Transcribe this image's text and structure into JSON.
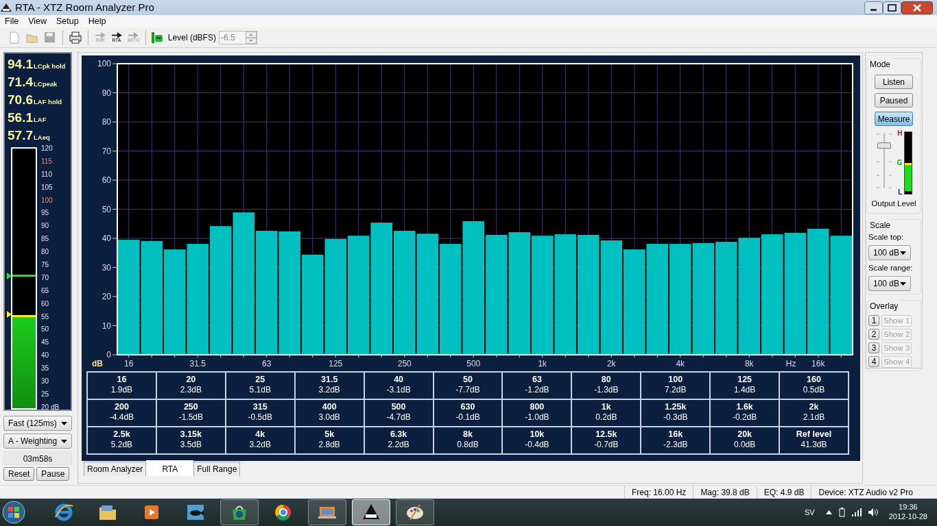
{
  "window": {
    "title": "RTA - XTZ Room Analyzer Pro"
  },
  "menu": [
    "File",
    "View",
    "Setup",
    "Help"
  ],
  "toolbar": {
    "buttons": [
      {
        "kind": "new",
        "disabled": true
      },
      {
        "kind": "open",
        "disabled": true
      },
      {
        "kind": "save",
        "disabled": true
      },
      {
        "kind": "print",
        "disabled": false
      },
      {
        "kind": "arrow",
        "label": "ROM",
        "disabled": true
      },
      {
        "kind": "arrow",
        "label": "RTA",
        "disabled": false
      },
      {
        "kind": "arrow",
        "label": "BOTH",
        "disabled": true
      }
    ],
    "level": {
      "label": "Level (dBFS)",
      "value": "-6.5",
      "disabled": true
    }
  },
  "readouts": [
    {
      "value": "94.1",
      "label": "LCpk hold"
    },
    {
      "value": "71.4",
      "label": "LCpeak"
    },
    {
      "value": "70.6",
      "label": "LAF hold"
    },
    {
      "value": "56.1",
      "label": "LAF"
    },
    {
      "value": "57.7",
      "label": "LAeq"
    }
  ],
  "meter": {
    "fill": {
      "level": 0.36
    },
    "hold": {
      "level": 0.506
    },
    "scale": [
      {
        "label": "120",
        "marked": false
      },
      {
        "label": "115",
        "marked": true
      },
      {
        "label": "110",
        "marked": false
      },
      {
        "label": "105",
        "marked": false
      },
      {
        "label": "100",
        "marked": true
      },
      {
        "label": "95",
        "marked": false
      },
      {
        "label": "90",
        "marked": false
      },
      {
        "label": "85",
        "marked": false
      },
      {
        "label": "80",
        "marked": false
      },
      {
        "label": "75",
        "marked": false
      },
      {
        "label": "70",
        "marked": false
      },
      {
        "label": "65",
        "marked": false
      },
      {
        "label": "60",
        "marked": false
      },
      {
        "label": "55",
        "marked": false
      },
      {
        "label": "50",
        "marked": false
      },
      {
        "label": "45",
        "marked": false
      },
      {
        "label": "40",
        "marked": false
      },
      {
        "label": "35",
        "marked": false
      },
      {
        "label": "30",
        "marked": false
      },
      {
        "label": "25",
        "marked": false
      },
      {
        "label": "20 dB",
        "marked": false
      }
    ]
  },
  "response_select": {
    "value": "Fast (125ms)"
  },
  "weighting_select": {
    "value": "A - Weighting"
  },
  "timer": "03m58s",
  "left_buttons": [
    "Reset",
    "Pause"
  ],
  "chart": {
    "chart_data": {
      "type": "bar",
      "xlabel": "Hz",
      "ylabel": "dB",
      "grid": true,
      "categories": [
        "16",
        null,
        null,
        "31.5",
        null,
        null,
        "63",
        null,
        null,
        "125",
        null,
        null,
        "250",
        null,
        null,
        "500",
        null,
        null,
        "1k",
        null,
        null,
        "2k",
        null,
        null,
        "4k",
        null,
        null,
        "8k",
        null,
        null,
        "16k",
        null
      ],
      "values": [
        39.5,
        39.1,
        36.2,
        38.1,
        44.2,
        48.9,
        42.6,
        42.4,
        34.4,
        39.8,
        40.9,
        45.4,
        42.6,
        41.6,
        38.1,
        45.9,
        41.2,
        42.1,
        40.9,
        41.4,
        41.2,
        39.3,
        36.2,
        38.1,
        38.1,
        38.4,
        38.8,
        40.2,
        41.4,
        41.9,
        43.3,
        40.9
      ],
      "ylim": [
        0,
        100
      ],
      "yticks": [
        0,
        10,
        20,
        30,
        40,
        50,
        60,
        70,
        80,
        90,
        100
      ]
    }
  },
  "band_table": {
    "rows": [
      [
        {
          "band": "16",
          "value": "1.9dB"
        },
        {
          "band": "20",
          "value": "2.3dB"
        },
        {
          "band": "25",
          "value": "5.1dB"
        },
        {
          "band": "31.5",
          "value": "3.2dB"
        },
        {
          "band": "40",
          "value": "-3.1dB"
        },
        {
          "band": "50",
          "value": "-7.7dB"
        },
        {
          "band": "63",
          "value": "-1.2dB"
        },
        {
          "band": "80",
          "value": "-1.3dB"
        },
        {
          "band": "100",
          "value": "7.2dB"
        },
        {
          "band": "125",
          "value": "1.4dB"
        },
        {
          "band": "160",
          "value": "0.5dB"
        }
      ],
      [
        {
          "band": "200",
          "value": "-4.4dB"
        },
        {
          "band": "250",
          "value": "-1.5dB"
        },
        {
          "band": "315",
          "value": "-0.5dB"
        },
        {
          "band": "400",
          "value": "3.0dB"
        },
        {
          "band": "500",
          "value": "-4.7dB"
        },
        {
          "band": "630",
          "value": "-0.1dB"
        },
        {
          "band": "800",
          "value": "-1.0dB"
        },
        {
          "band": "1k",
          "value": "0.2dB"
        },
        {
          "band": "1.25k",
          "value": "-0.3dB"
        },
        {
          "band": "1.6k",
          "value": "-0.2dB"
        },
        {
          "band": "2k",
          "value": "2.1dB"
        }
      ],
      [
        {
          "band": "2.5k",
          "value": "5.2dB"
        },
        {
          "band": "3.15k",
          "value": "3.5dB"
        },
        {
          "band": "4k",
          "value": "3.2dB"
        },
        {
          "band": "5k",
          "value": "2.8dB"
        },
        {
          "band": "6.3k",
          "value": "2.2dB"
        },
        {
          "band": "8k",
          "value": "0.8dB"
        },
        {
          "band": "10k",
          "value": "-0.4dB"
        },
        {
          "band": "12.5k",
          "value": "-0.7dB"
        },
        {
          "band": "16k",
          "value": "-2.3dB"
        },
        {
          "band": "20k",
          "value": "0.0dB"
        },
        {
          "band": "Ref level",
          "value": "41.3dB"
        }
      ]
    ]
  },
  "mode": {
    "title": "Mode",
    "buttons": [
      {
        "label": "Listen",
        "selected": false
      },
      {
        "label": "Paused",
        "selected": false
      },
      {
        "label": "Measure",
        "selected": true
      }
    ]
  },
  "output": {
    "slider": {
      "level": 0.78
    },
    "meter": {
      "level": 0.5
    },
    "marks": [
      "H",
      "G",
      "L"
    ],
    "label": "Output Level"
  },
  "scale": {
    "title": "Scale",
    "top_label": "Scale top:",
    "top_value": "100 dB",
    "range_label": "Scale range:",
    "range_value": "100 dB"
  },
  "overlay": {
    "title": "Overlay",
    "items": [
      {
        "number": "1",
        "label": "Show 1",
        "disabled": true
      },
      {
        "number": "2",
        "label": "Show 2",
        "disabled": true
      },
      {
        "number": "3",
        "label": "Show 3",
        "disabled": true
      },
      {
        "number": "4",
        "label": "Show 4",
        "disabled": true
      }
    ]
  },
  "tabs": [
    {
      "label": "Room Analyzer",
      "selected": false
    },
    {
      "label": "RTA",
      "selected": true
    },
    {
      "label": "Full Range",
      "selected": false
    }
  ],
  "status_bar": [
    "Freq: 16.00 Hz",
    "Mag: 39.8 dB",
    "EQ: 4.9 dB",
    "Device: XTZ Audio v2 Pro"
  ],
  "taskbar": {
    "apps": [
      {
        "kind": "globe",
        "running": false,
        "selected": false
      },
      {
        "kind": "folder",
        "running": false,
        "selected": false
      },
      {
        "kind": "play",
        "running": false,
        "selected": false
      },
      {
        "kind": "fish",
        "running": false,
        "selected": false
      },
      {
        "kind": "bag",
        "running": true,
        "selected": false
      },
      {
        "kind": "ring",
        "running": false,
        "selected": false
      },
      {
        "kind": "window",
        "running": true,
        "selected": false
      },
      {
        "kind": "mountain",
        "running": true,
        "selected": true
      },
      {
        "kind": "palette",
        "running": true,
        "selected": false
      }
    ],
    "language": "SV",
    "time": "19:36",
    "date": "2012-10-28"
  }
}
